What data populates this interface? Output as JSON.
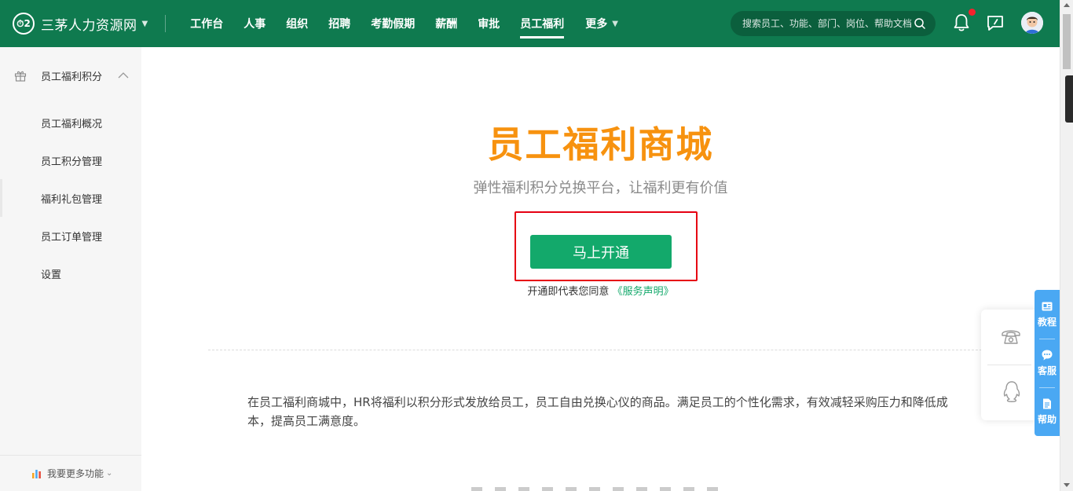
{
  "header": {
    "brand_name": "三茅人力资源网",
    "nav": [
      "工作台",
      "人事",
      "组织",
      "招聘",
      "考勤假期",
      "薪酬",
      "审批",
      "员工福利"
    ],
    "active_nav": "员工福利",
    "more_label": "更多",
    "search_placeholder": "搜索员工、功能、部门、岗位、帮助文档"
  },
  "sidebar": {
    "group_label": "员工福利积分",
    "items": [
      "员工福利概况",
      "员工积分管理",
      "福利礼包管理",
      "员工订单管理",
      "设置"
    ],
    "active_item": "福利礼包管理",
    "footer_label": "我要更多功能"
  },
  "main": {
    "title": "员工福利商城",
    "subtitle": "弹性福利积分兑换平台，让福利更有价值",
    "cta_label": "马上开通",
    "agree_prefix": "开通即代表您同意",
    "agree_link": "《服务声明》",
    "intro": "在员工福利商城中，HR将福利以积分形式发放给员工，员工自由兑换心仪的商品。满足员工的个性化需求，有效减轻采购压力和降低成本，提高员工满意度。"
  },
  "tools": {
    "tutorial": "教程",
    "service": "客服",
    "help": "帮助"
  },
  "icons": {
    "brand": "logo-icon",
    "search": "search-icon",
    "notification": "bell-icon",
    "chat": "chat-check-icon",
    "avatar": "user-avatar",
    "gift": "gift-icon",
    "phone": "phone-icon",
    "qq": "qq-penguin-icon"
  },
  "colors": {
    "header_bg": "#0f7a4f",
    "title_orange": "#f7920f",
    "cta_green": "#13a96b",
    "highlight_red": "#e60012",
    "tools_blue": "#4aa8f3"
  }
}
